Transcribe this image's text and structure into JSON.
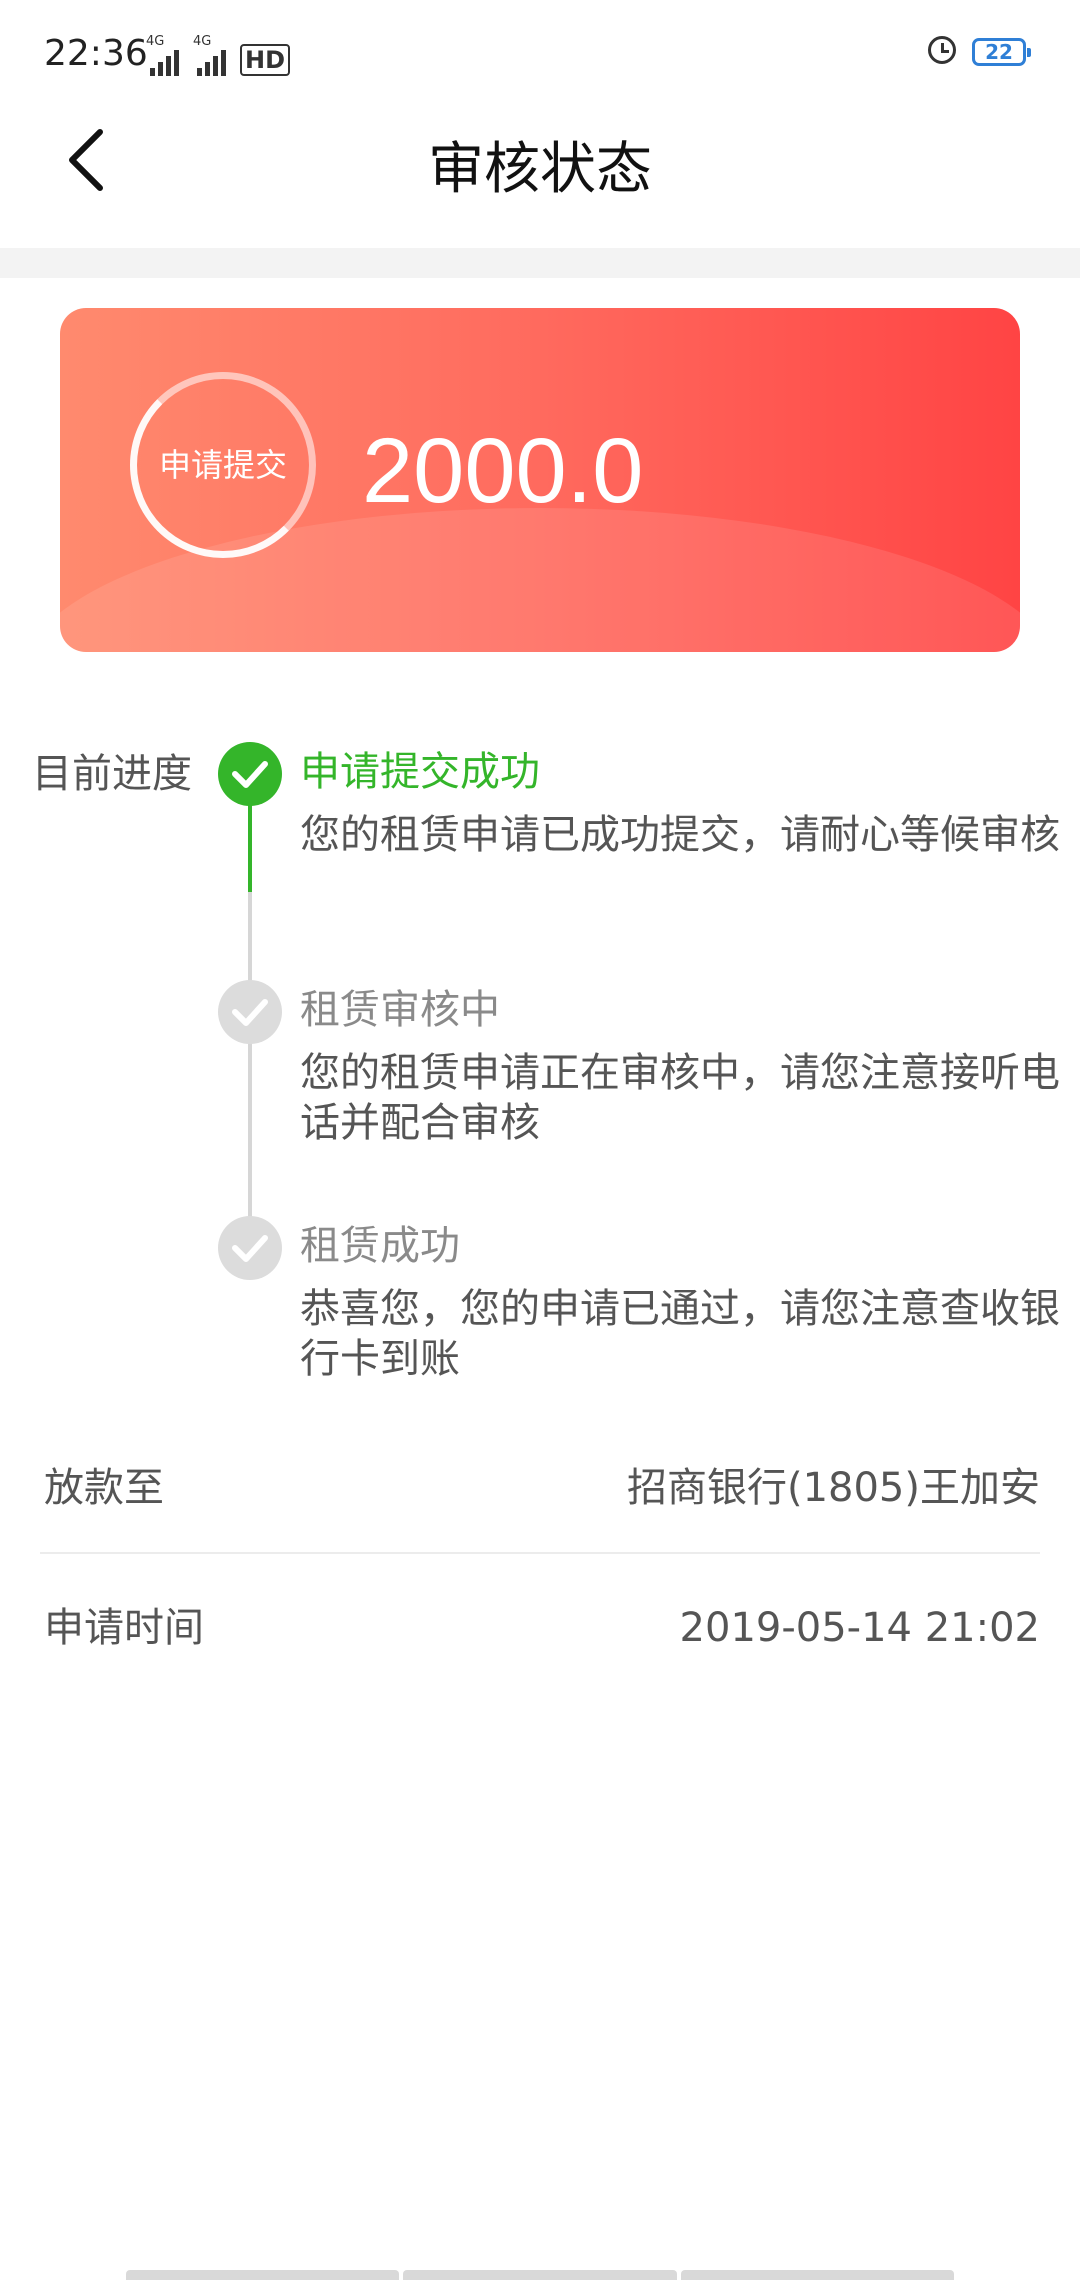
{
  "status_bar": {
    "time": "22:36",
    "network_1": "4G",
    "network_2": "4G",
    "hd_label": "HD",
    "battery": "22"
  },
  "header": {
    "title": "审核状态",
    "back_icon": "chevron-left-icon"
  },
  "card": {
    "ring_label": "申请提交",
    "amount": "2000.0",
    "colors": {
      "start": "#ff8a6e",
      "end": "#ff4444"
    }
  },
  "progress": {
    "label": "目前进度",
    "steps": [
      {
        "title": "申请提交成功",
        "desc": "您的租赁申请已成功提交，请耐心等候审核",
        "state": "done"
      },
      {
        "title": "租赁审核中",
        "desc": "您的租赁申请正在审核中，请您注意接听电\n话并配合审核",
        "state": "pending"
      },
      {
        "title": "租赁成功",
        "desc": "恭喜您，您的申请已通过，请您注意查收银\n行卡到账",
        "state": "pending"
      }
    ],
    "colors": {
      "active": "#34b52a",
      "pending": "#dcdcdc"
    }
  },
  "info": {
    "payout_label": "放款至",
    "payout_value": "招商银行(1805)王加安",
    "apply_time_label": "申请时间",
    "apply_time_value": "2019-05-14 21:02"
  }
}
